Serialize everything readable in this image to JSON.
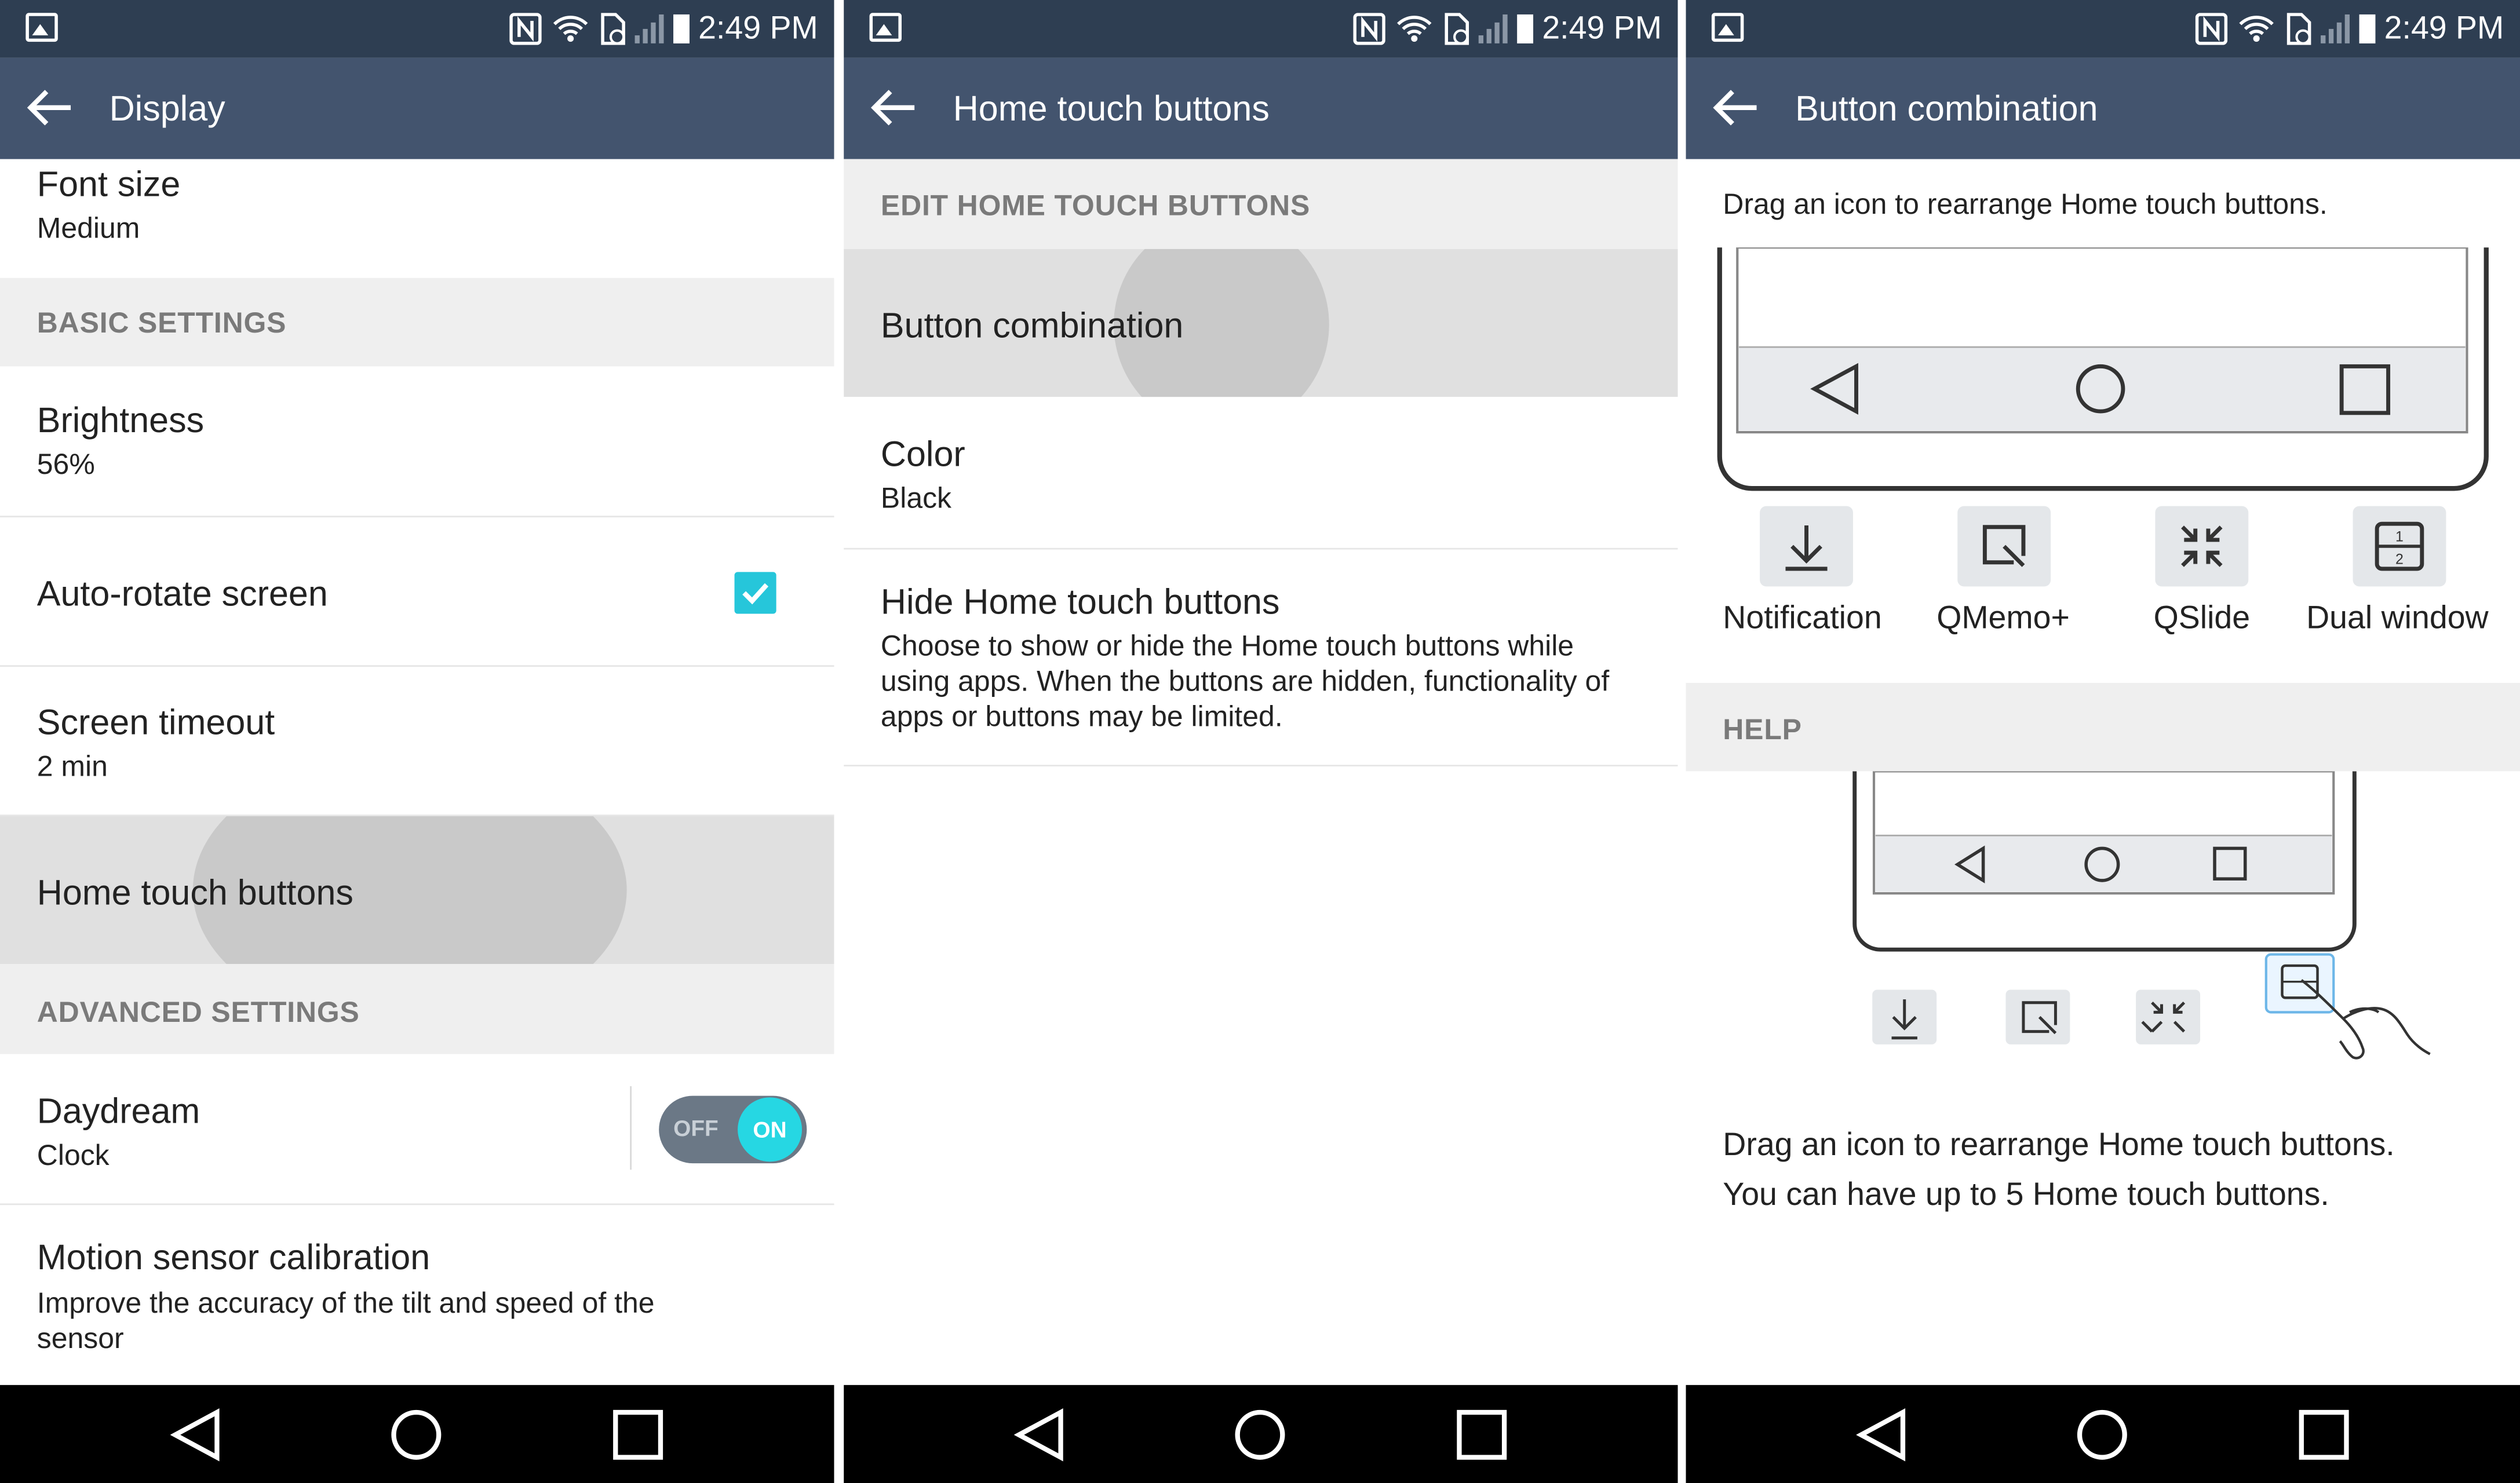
{
  "status_bar": {
    "time": "2:49 PM"
  },
  "panel1": {
    "title": "Display",
    "font_size": {
      "title": "Font size",
      "value": "Medium"
    },
    "basic_settings": "BASIC SETTINGS",
    "brightness": {
      "title": "Brightness",
      "value": "56%"
    },
    "auto_rotate": {
      "title": "Auto-rotate screen",
      "checked": true
    },
    "screen_timeout": {
      "title": "Screen timeout",
      "value": "2 min"
    },
    "home_touch": {
      "title": "Home touch buttons"
    },
    "advanced_settings": "ADVANCED SETTINGS",
    "daydream": {
      "title": "Daydream",
      "value": "Clock",
      "toggle_off": "OFF",
      "toggle_on": "ON"
    },
    "motion": {
      "title": "Motion sensor calibration",
      "desc": "Improve the accuracy of the tilt and speed of the sensor"
    }
  },
  "panel2": {
    "title": "Home touch buttons",
    "section": "EDIT HOME TOUCH BUTTONS",
    "button_combination": "Button combination",
    "color": {
      "title": "Color",
      "value": "Black"
    },
    "hide": {
      "title": "Hide Home touch buttons",
      "desc": "Choose to show or hide the Home touch buttons while using apps. When the buttons are hidden, functionality of apps or buttons may be limited."
    }
  },
  "panel3": {
    "title": "Button combination",
    "instruction": "Drag an icon to rearrange Home touch buttons.",
    "options": [
      {
        "label": "Notification",
        "icon": "notification-down-icon"
      },
      {
        "label": "QMemo+",
        "icon": "qmemo-icon"
      },
      {
        "label": "QSlide",
        "icon": "qslide-icon"
      },
      {
        "label": "Dual window",
        "icon": "dual-window-icon"
      }
    ],
    "help": "HELP",
    "help_text_1": "Drag an icon to rearrange Home touch buttons.",
    "help_text_2": "You can have up to 5 Home touch buttons."
  },
  "colors": {
    "status_bar": "#2e3e52",
    "app_bar": "#43546e",
    "accent": "#26c6da"
  }
}
